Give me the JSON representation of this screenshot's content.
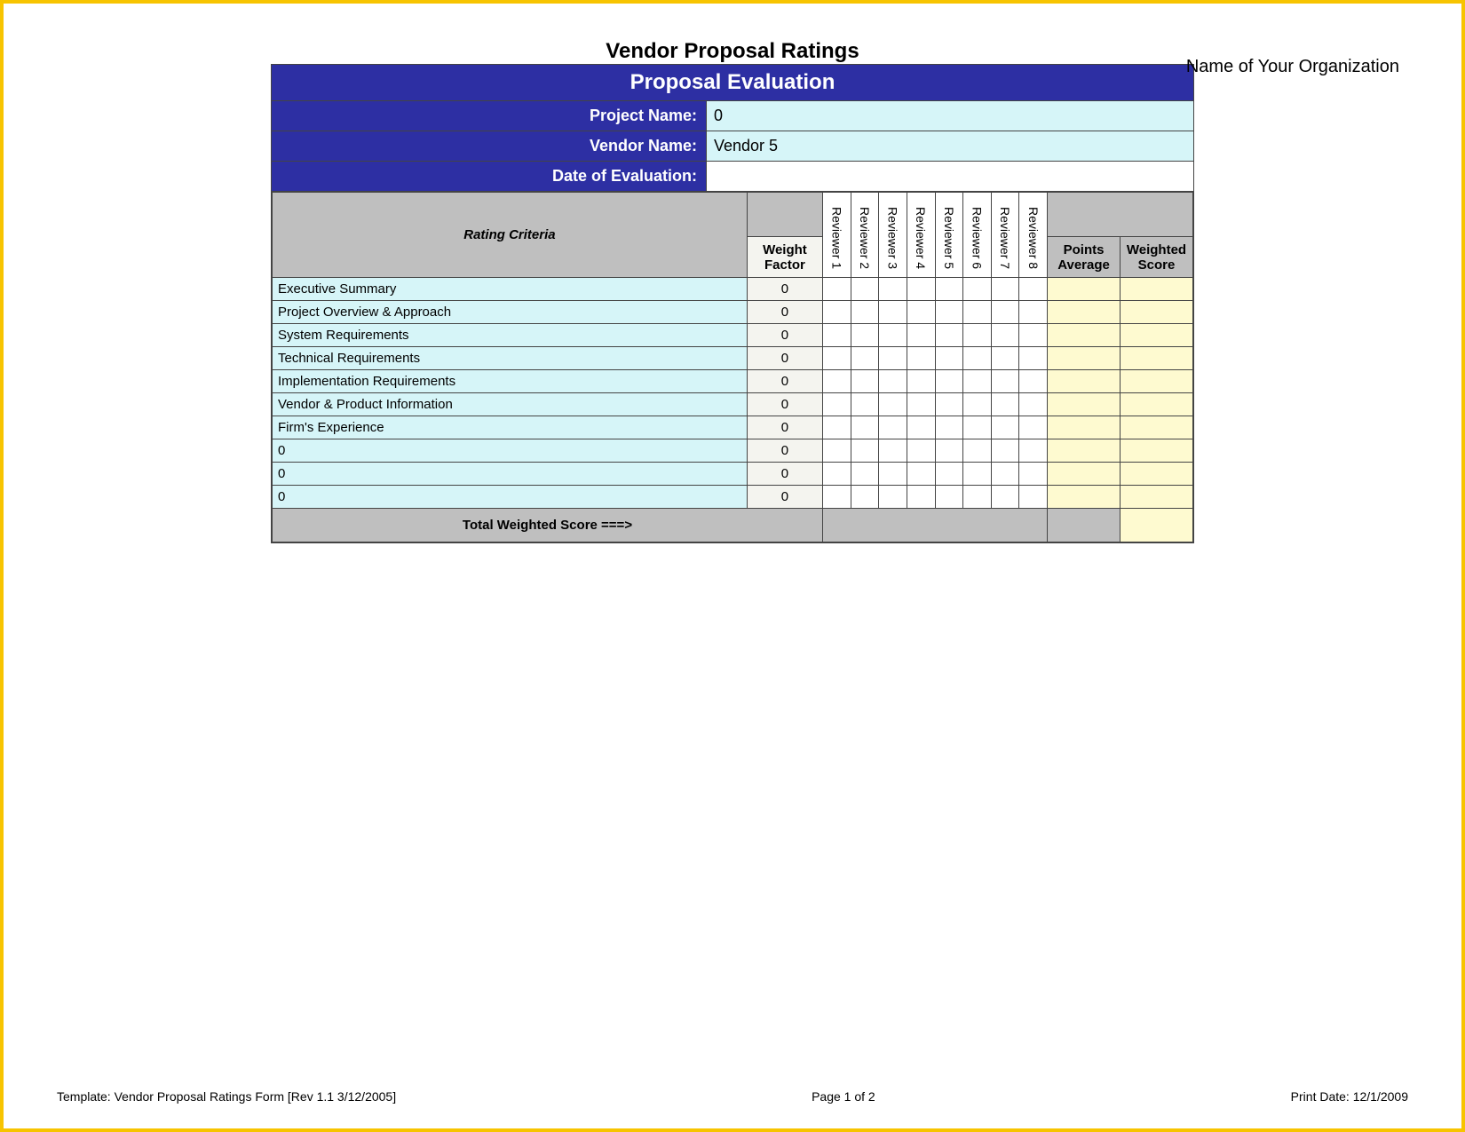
{
  "page_title": "Vendor Proposal Ratings",
  "org_placeholder": "Name of Your Organization",
  "form_title": "Proposal Evaluation",
  "meta": {
    "project_label": "Project Name:",
    "project_value": "0",
    "vendor_label": "Vendor Name:",
    "vendor_value": "Vendor 5",
    "date_label": "Date of Evaluation:",
    "date_value": ""
  },
  "headers": {
    "criteria": "Rating Criteria",
    "weight": "Weight Factor",
    "reviewers": [
      "Reviewer 1",
      "Reviewer 2",
      "Reviewer 3",
      "Reviewer 4",
      "Reviewer 5",
      "Reviewer 6",
      "Reviewer 7",
      "Reviewer 8"
    ],
    "points_avg": "Points Average",
    "weighted_score": "Weighted Score"
  },
  "rows": [
    {
      "criteria": "Executive Summary",
      "weight": "0"
    },
    {
      "criteria": "Project Overview & Approach",
      "weight": "0"
    },
    {
      "criteria": "System Requirements",
      "weight": "0"
    },
    {
      "criteria": "Technical Requirements",
      "weight": "0"
    },
    {
      "criteria": "Implementation Requirements",
      "weight": "0"
    },
    {
      "criteria": "Vendor & Product Information",
      "weight": "0"
    },
    {
      "criteria": "Firm's Experience",
      "weight": "0"
    },
    {
      "criteria": "0",
      "weight": "0"
    },
    {
      "criteria": "0",
      "weight": "0"
    },
    {
      "criteria": "0",
      "weight": "0"
    }
  ],
  "total_label": "Total Weighted Score ===>",
  "footer": {
    "template": "Template: Vendor Proposal Ratings Form [Rev 1.1 3/12/2005]",
    "page": "Page 1 of 2",
    "print_date": "Print Date: 12/1/2009"
  }
}
